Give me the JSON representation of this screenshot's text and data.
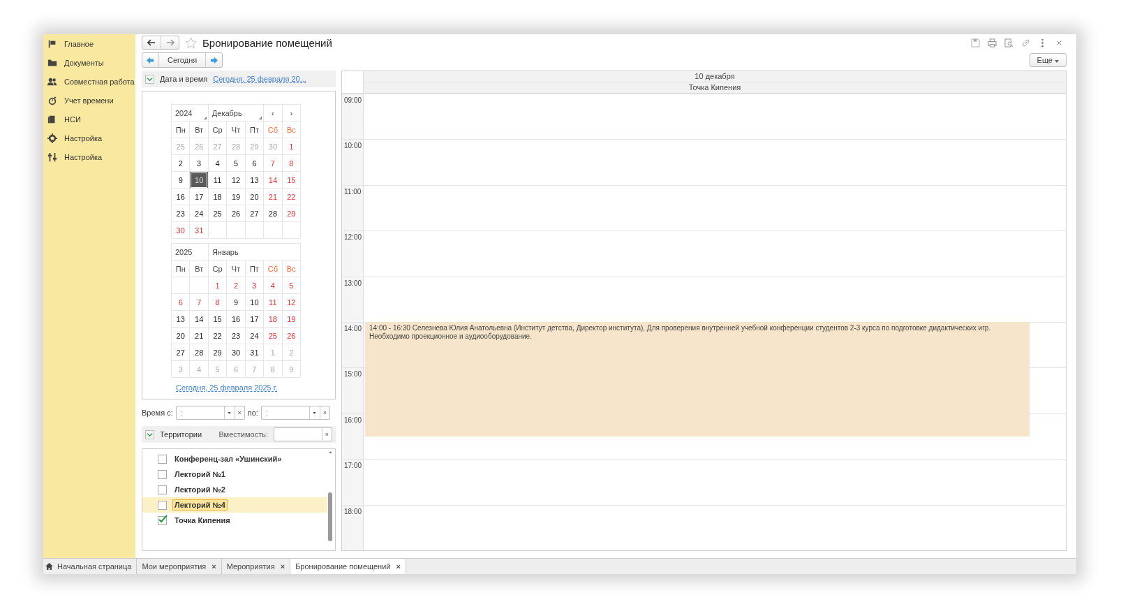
{
  "sidebar": {
    "items": [
      {
        "label": "Главное",
        "kind": "flag"
      },
      {
        "label": "Документы",
        "kind": "folder"
      },
      {
        "label": "Совместная работа",
        "kind": "people"
      },
      {
        "label": "Учет времени",
        "kind": "timer"
      },
      {
        "label": "НСИ",
        "kind": "books"
      },
      {
        "label": "Настройка",
        "kind": "gear"
      },
      {
        "label": "Настройка",
        "kind": "sliders"
      }
    ]
  },
  "title": "Бронирование помещений",
  "toolbar": {
    "today_button": "Сегодня",
    "more_button": "Еще"
  },
  "date_group": {
    "label": "Дата и время",
    "expanded": true,
    "link": "Сегодня, 25 февраля 20..."
  },
  "months": [
    {
      "year": "2024",
      "month": "Декабрь",
      "prev": "‹",
      "next": "›",
      "weekdays": [
        {
          "t": "Пн",
          "kind": "workday"
        },
        {
          "t": "Вт",
          "kind": "workday"
        },
        {
          "t": "Ср",
          "kind": "workday"
        },
        {
          "t": "Чт",
          "kind": "workday"
        },
        {
          "t": "Пт",
          "kind": "workday"
        },
        {
          "t": "Сб",
          "kind": "weekend"
        },
        {
          "t": "Вс",
          "kind": "weekend"
        }
      ],
      "weeks": [
        [
          {
            "t": "25",
            "kind": "other",
            "selected": false
          },
          {
            "t": "26",
            "kind": "other",
            "selected": false
          },
          {
            "t": "27",
            "kind": "other",
            "selected": false
          },
          {
            "t": "28",
            "kind": "other",
            "selected": false
          },
          {
            "t": "29",
            "kind": "other",
            "selected": false
          },
          {
            "t": "30",
            "kind": "other",
            "selected": false
          },
          {
            "t": "1",
            "kind": "holiday",
            "selected": false
          }
        ],
        [
          {
            "t": "2",
            "kind": "workday",
            "selected": false
          },
          {
            "t": "3",
            "kind": "workday",
            "selected": false
          },
          {
            "t": "4",
            "kind": "workday",
            "selected": false
          },
          {
            "t": "5",
            "kind": "workday",
            "selected": false
          },
          {
            "t": "6",
            "kind": "workday",
            "selected": false
          },
          {
            "t": "7",
            "kind": "holiday",
            "selected": false
          },
          {
            "t": "8",
            "kind": "holiday",
            "selected": false
          }
        ],
        [
          {
            "t": "9",
            "kind": "workday",
            "selected": false
          },
          {
            "t": "10",
            "kind": "workday",
            "selected": true
          },
          {
            "t": "11",
            "kind": "workday",
            "selected": false
          },
          {
            "t": "12",
            "kind": "workday",
            "selected": false
          },
          {
            "t": "13",
            "kind": "workday",
            "selected": false
          },
          {
            "t": "14",
            "kind": "holiday",
            "selected": false
          },
          {
            "t": "15",
            "kind": "holiday",
            "selected": false
          }
        ],
        [
          {
            "t": "16",
            "kind": "workday",
            "selected": false
          },
          {
            "t": "17",
            "kind": "workday",
            "selected": false
          },
          {
            "t": "18",
            "kind": "workday",
            "selected": false
          },
          {
            "t": "19",
            "kind": "workday",
            "selected": false
          },
          {
            "t": "20",
            "kind": "workday",
            "selected": false
          },
          {
            "t": "21",
            "kind": "holiday",
            "selected": false
          },
          {
            "t": "22",
            "kind": "holiday",
            "selected": false
          }
        ],
        [
          {
            "t": "23",
            "kind": "workday",
            "selected": false
          },
          {
            "t": "24",
            "kind": "workday",
            "selected": false
          },
          {
            "t": "25",
            "kind": "workday",
            "selected": false
          },
          {
            "t": "26",
            "kind": "workday",
            "selected": false
          },
          {
            "t": "27",
            "kind": "workday",
            "selected": false
          },
          {
            "t": "28",
            "kind": "workday",
            "selected": false
          },
          {
            "t": "29",
            "kind": "holiday",
            "selected": false
          }
        ],
        [
          {
            "t": "30",
            "kind": "holiday",
            "selected": false
          },
          {
            "t": "31",
            "kind": "holiday",
            "selected": false
          },
          {
            "kind": "blank"
          },
          {
            "kind": "blank"
          },
          {
            "kind": "blank"
          },
          {
            "kind": "blank"
          },
          {
            "kind": "blank"
          }
        ]
      ]
    },
    {
      "year": "2025",
      "month": "Январь",
      "weekdays": [
        {
          "t": "Пн",
          "kind": "workday"
        },
        {
          "t": "Вт",
          "kind": "workday"
        },
        {
          "t": "Ср",
          "kind": "workday"
        },
        {
          "t": "Чт",
          "kind": "workday"
        },
        {
          "t": "Пт",
          "kind": "workday"
        },
        {
          "t": "Сб",
          "kind": "weekend"
        },
        {
          "t": "Вс",
          "kind": "weekend"
        }
      ],
      "weeks": [
        [
          {
            "kind": "blank"
          },
          {
            "kind": "blank"
          },
          {
            "t": "1",
            "kind": "holiday",
            "selected": false
          },
          {
            "t": "2",
            "kind": "holiday",
            "selected": false
          },
          {
            "t": "3",
            "kind": "holiday",
            "selected": false
          },
          {
            "t": "4",
            "kind": "holiday",
            "selected": false
          },
          {
            "t": "5",
            "kind": "holiday",
            "selected": false
          }
        ],
        [
          {
            "t": "6",
            "kind": "holiday",
            "selected": false
          },
          {
            "t": "7",
            "kind": "holiday",
            "selected": false
          },
          {
            "t": "8",
            "kind": "holiday",
            "selected": false
          },
          {
            "t": "9",
            "kind": "workday",
            "selected": false
          },
          {
            "t": "10",
            "kind": "workday",
            "selected": false
          },
          {
            "t": "11",
            "kind": "holiday",
            "selected": false
          },
          {
            "t": "12",
            "kind": "holiday",
            "selected": false
          }
        ],
        [
          {
            "t": "13",
            "kind": "workday",
            "selected": false
          },
          {
            "t": "14",
            "kind": "workday",
            "selected": false
          },
          {
            "t": "15",
            "kind": "workday",
            "selected": false
          },
          {
            "t": "16",
            "kind": "workday",
            "selected": false
          },
          {
            "t": "17",
            "kind": "workday",
            "selected": false
          },
          {
            "t": "18",
            "kind": "holiday",
            "selected": false
          },
          {
            "t": "19",
            "kind": "holiday",
            "selected": false
          }
        ],
        [
          {
            "t": "20",
            "kind": "workday",
            "selected": false
          },
          {
            "t": "21",
            "kind": "workday",
            "selected": false
          },
          {
            "t": "22",
            "kind": "workday",
            "selected": false
          },
          {
            "t": "23",
            "kind": "workday",
            "selected": false
          },
          {
            "t": "24",
            "kind": "workday",
            "selected": false
          },
          {
            "t": "25",
            "kind": "holiday",
            "selected": false
          },
          {
            "t": "26",
            "kind": "holiday",
            "selected": false
          }
        ],
        [
          {
            "t": "27",
            "kind": "workday",
            "selected": false
          },
          {
            "t": "28",
            "kind": "workday",
            "selected": false
          },
          {
            "t": "29",
            "kind": "workday",
            "selected": false
          },
          {
            "t": "30",
            "kind": "workday",
            "selected": false
          },
          {
            "t": "31",
            "kind": "workday",
            "selected": false
          },
          {
            "t": "1",
            "kind": "other",
            "selected": false
          },
          {
            "t": "2",
            "kind": "other",
            "selected": false
          }
        ],
        [
          {
            "t": "3",
            "kind": "other",
            "selected": false
          },
          {
            "t": "4",
            "kind": "other",
            "selected": false
          },
          {
            "t": "5",
            "kind": "other",
            "selected": false
          },
          {
            "t": "6",
            "kind": "other",
            "selected": false
          },
          {
            "t": "7",
            "kind": "other",
            "selected": false
          },
          {
            "t": "8",
            "kind": "other",
            "selected": false
          },
          {
            "t": "9",
            "kind": "other",
            "selected": false
          }
        ]
      ]
    }
  ],
  "today_link": "Сегодня, 25 февраля 2025 г.",
  "time_filter": {
    "from_label": "Время с:",
    "from_placeholder": ":",
    "to_label": "по:",
    "to_placeholder": ":",
    "clear": "×"
  },
  "territories": {
    "label": "Территории",
    "expanded": true,
    "capacity_label": "Вместимость:",
    "clear": "×",
    "items": [
      {
        "label": "Конференц-зал «Ушинский»",
        "checked": false,
        "selected": false
      },
      {
        "label": "Лекторий №1",
        "checked": false,
        "selected": false
      },
      {
        "label": "Лекторий №2",
        "checked": false,
        "selected": false
      },
      {
        "label": "Лекторий №4",
        "checked": false,
        "selected": true
      },
      {
        "label": "Точка Кипения",
        "checked": true,
        "selected": false
      }
    ]
  },
  "schedule": {
    "date": "10 декабря",
    "room": "Точка Кипения",
    "hours": [
      "09:00",
      "10:00",
      "11:00",
      "12:00",
      "13:00",
      "14:00",
      "15:00",
      "16:00",
      "17:00",
      "18:00"
    ],
    "events": [
      {
        "time": "14:00 - 16:30",
        "text": "Селезнева Юлия Анатольевна (Институт детства, Директор института), Для проверения внутренней учебной конференции студентов 2-3 курса по подготовке дидактических игр. Необходимо проекционное и аудиооборудование."
      }
    ]
  },
  "tabs": [
    {
      "label": "Начальная страница",
      "kind": "home",
      "selected": false
    },
    {
      "label": "Мои мероприятия",
      "kind": "closable",
      "close": "×",
      "selected": false
    },
    {
      "label": "Мероприятия",
      "kind": "closable",
      "close": "×",
      "selected": false
    },
    {
      "label": "Бронирование помещений",
      "kind": "closable",
      "close": "×",
      "selected": true
    }
  ]
}
